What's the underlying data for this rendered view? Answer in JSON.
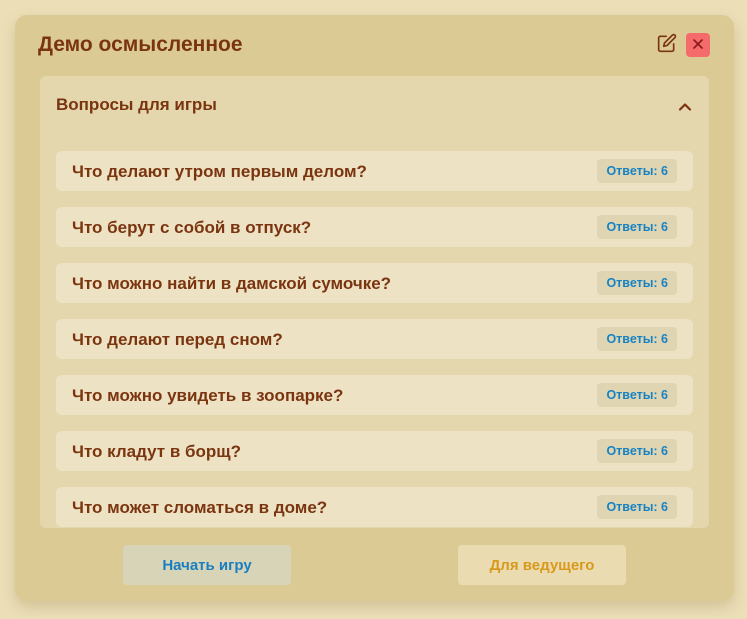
{
  "dialog": {
    "title": "Демо осмысленное",
    "edit_icon": "pencil-square-icon",
    "close_icon": "close-x-icon",
    "close_color": "#f56a6a"
  },
  "panel": {
    "title": "Вопросы для игры",
    "toggle_icon": "chevron-up-icon",
    "questions": [
      {
        "text": "Что делают утром первым делом?",
        "badge": "Ответы: 6"
      },
      {
        "text": "Что берут с собой в отпуск?",
        "badge": "Ответы: 6"
      },
      {
        "text": "Что можно найти в дамской сумочке?",
        "badge": "Ответы: 6"
      },
      {
        "text": "Что делают перед сном?",
        "badge": "Ответы: 6"
      },
      {
        "text": "Что можно увидеть в зоопарке?",
        "badge": "Ответы: 6"
      },
      {
        "text": "Что кладут в борщ?",
        "badge": "Ответы: 6"
      },
      {
        "text": "Что может сломаться в доме?",
        "badge": "Ответы: 6"
      }
    ]
  },
  "actions": {
    "start_label": "Начать игру",
    "host_label": "Для ведущего"
  },
  "colors": {
    "background": "#ecdfb8",
    "card": "#dcca94",
    "title_text": "#7a3510",
    "badge_text": "#1783c3",
    "host_text": "#d99a1c"
  }
}
